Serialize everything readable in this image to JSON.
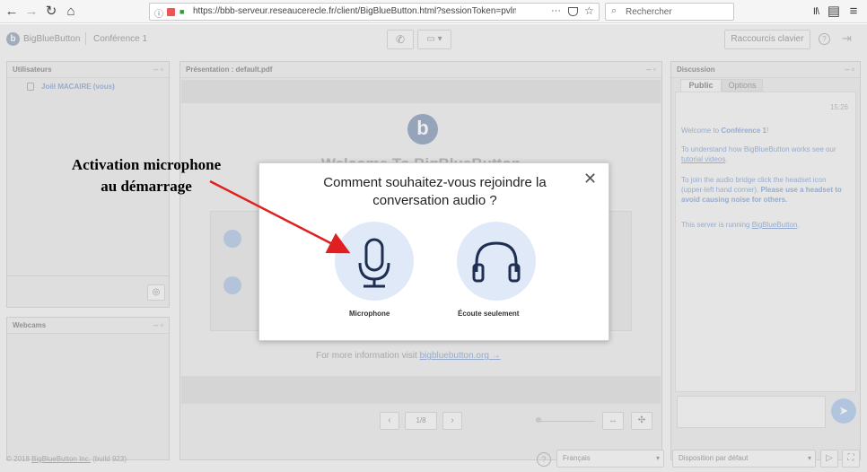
{
  "browser": {
    "url": "https://bbb-serveur.reseaucerecle.fr/client/BigBlueButton.html?sessionToken=pvlmqrn",
    "search_placeholder": "Rechercher",
    "more_label": "···"
  },
  "app": {
    "brand": "BigBlueButton",
    "conference": "Conférence 1",
    "shortcuts_label": "Raccourcis clavier"
  },
  "users_panel": {
    "title": "Utilisateurs",
    "user_name": "Joël MACAIRE (vous)"
  },
  "webcam_panel": {
    "title": "Webcams"
  },
  "presentation_panel": {
    "title": "Présentation : default.pdf",
    "welcome_heading": "Welcome To BigBlueButton",
    "more_info": "For more information visit",
    "more_info_link": "bigbluebutton.org →",
    "page_indicator": "1/8"
  },
  "chat_panel": {
    "title": "Discussion",
    "tabs": [
      "Public",
      "Options"
    ],
    "time": "15:26",
    "msg1_prefix": "Welcome to ",
    "msg1_bold": "Conférence 1",
    "msg1_suffix": "!",
    "msg2_prefix": "To understand how BigBlueButton works see our ",
    "msg2_link": "tutorial videos",
    "msg2_suffix": ".",
    "msg3_prefix": "To join the audio bridge click the headset icon (upper-left hand corner). ",
    "msg3_bold": "Please use a headset to avoid causing noise for others.",
    "msg4_prefix": "This server is running ",
    "msg4_link": "BigBlueButton",
    "msg4_suffix": "."
  },
  "footer": {
    "copyright": "© 2018 ",
    "copyright_link": "BigBlueButton Inc.",
    "build": " (build 923)",
    "language": "Français",
    "layout": "Disposition par défaut"
  },
  "modal": {
    "title": "Comment souhaitez-vous rejoindre la conversation audio ?",
    "microphone_label": "Microphone",
    "listen_label": "Écoute seulement"
  },
  "annotation": {
    "line1": "Activation microphone",
    "line2": "au démarrage",
    "color": "#e02020"
  },
  "colors": {
    "accent": "#4a90d9",
    "icon_dark": "#1f2f52",
    "choice_bg": "#dfe9f7"
  }
}
